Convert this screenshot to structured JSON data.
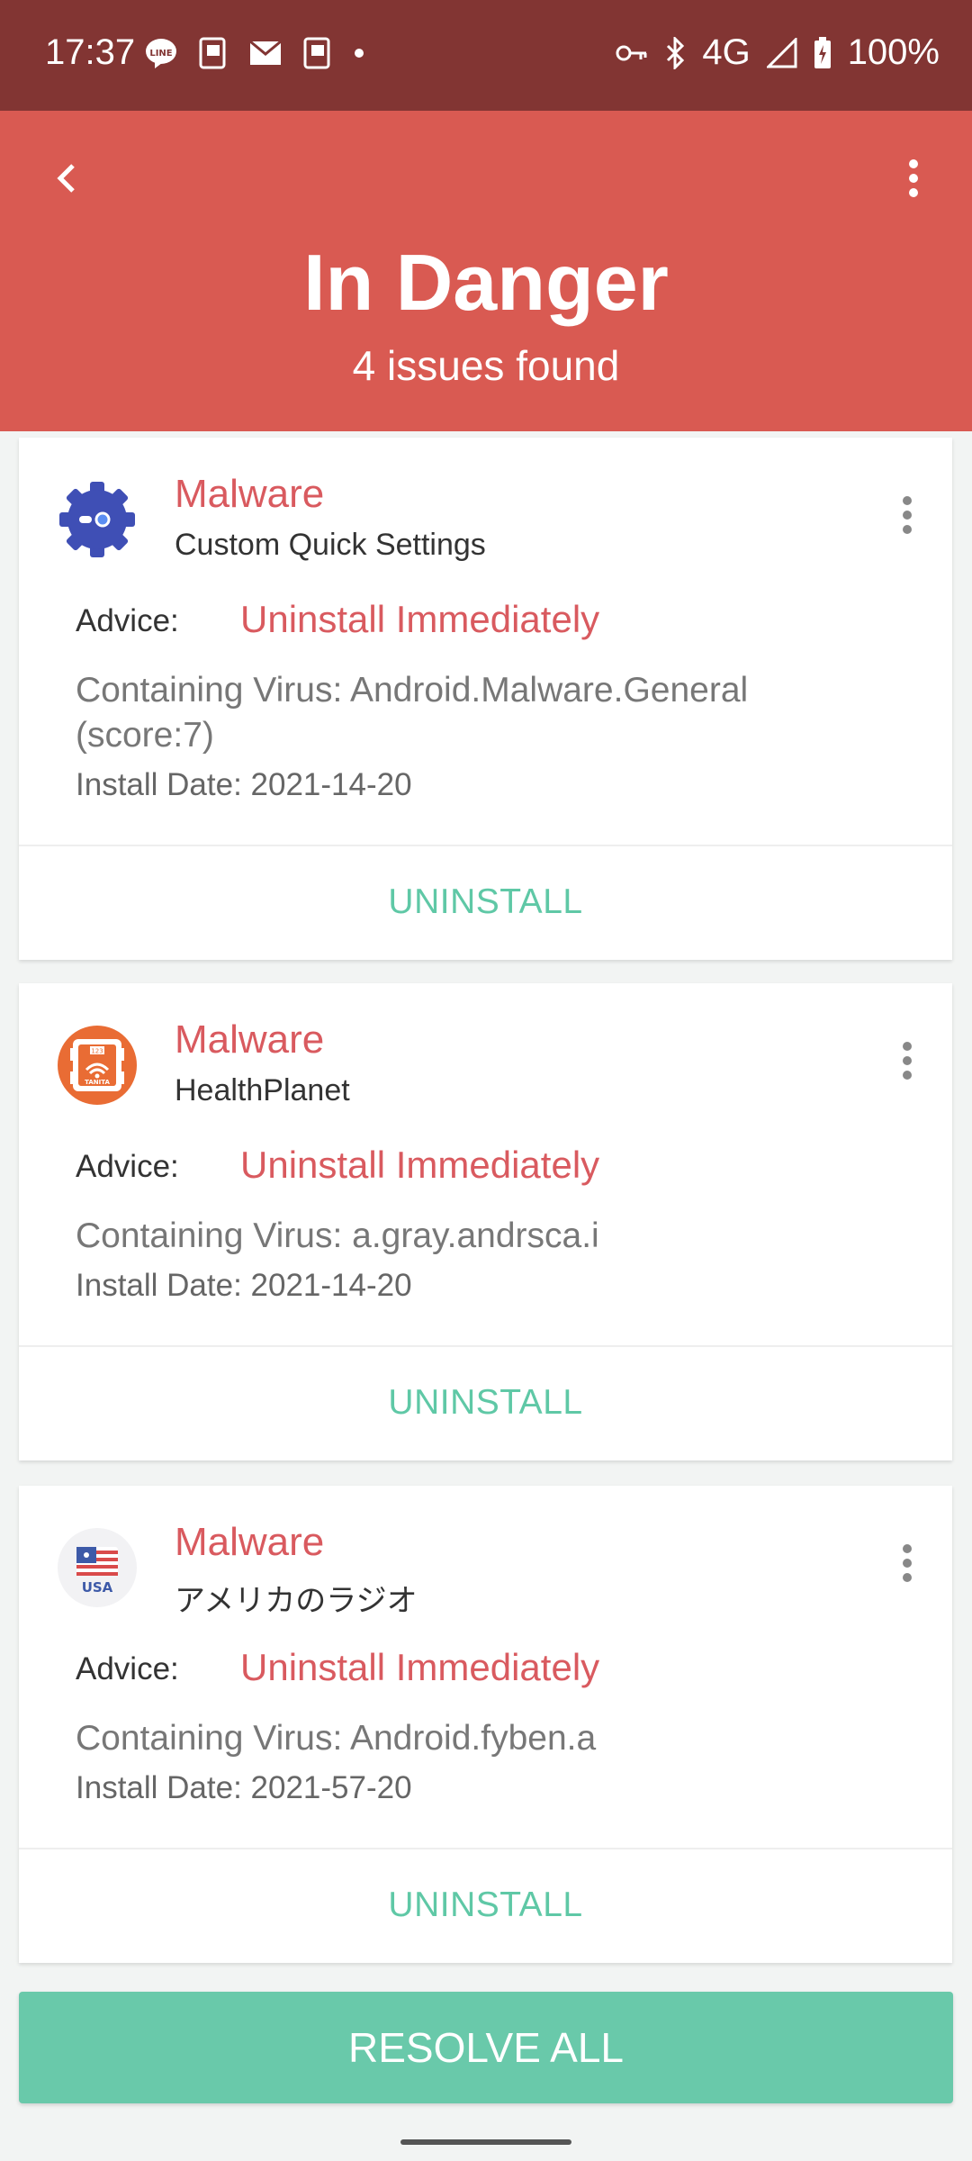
{
  "status_bar": {
    "time": "17:37",
    "network": "4G",
    "battery": "100%",
    "icons": [
      "line-icon",
      "notification-icon",
      "mail-icon",
      "notification-icon",
      "dot-icon",
      "vpn-key-icon",
      "bluetooth-icon",
      "signal-icon",
      "battery-icon"
    ]
  },
  "header": {
    "title": "In Danger",
    "subtitle": "4 issues found",
    "background_color": "#d95a52"
  },
  "cards": [
    {
      "type": "Malware",
      "app_name": "Custom Quick Settings",
      "advice_label": "Advice:",
      "advice_value": "Uninstall Immediately",
      "virus_line1": "Containing Virus: Android.Malware.General",
      "virus_line2": "(score:7)",
      "install_date": "Install Date: 2021-14-20",
      "action": "UNINSTALL",
      "icon": "gear-icon"
    },
    {
      "type": "Malware",
      "app_name": "HealthPlanet",
      "advice_label": "Advice:",
      "advice_value": "Uninstall Immediately",
      "virus_line1": "Containing Virus: a.gray.andrsca.i",
      "install_date": "Install Date: 2021-14-20",
      "action": "UNINSTALL",
      "icon": "scale-icon",
      "icon_text": "TANITA",
      "icon_screen_text": "123"
    },
    {
      "type": "Malware",
      "app_name": "アメリカのラジオ",
      "advice_label": "Advice:",
      "advice_value": "Uninstall Immediately",
      "virus_line1": "Containing Virus: Android.fyben.a",
      "install_date": "Install Date: 2021-57-20",
      "action": "UNINSTALL",
      "icon": "usa-flag-icon",
      "icon_text": "USA"
    }
  ],
  "resolve_all": "RESOLVE ALL",
  "colors": {
    "status_bar": "#823533",
    "danger": "#d95a52",
    "accent_red": "#d95a5f",
    "accent_green": "#5fc8a6",
    "button_green": "#69c9aa"
  }
}
